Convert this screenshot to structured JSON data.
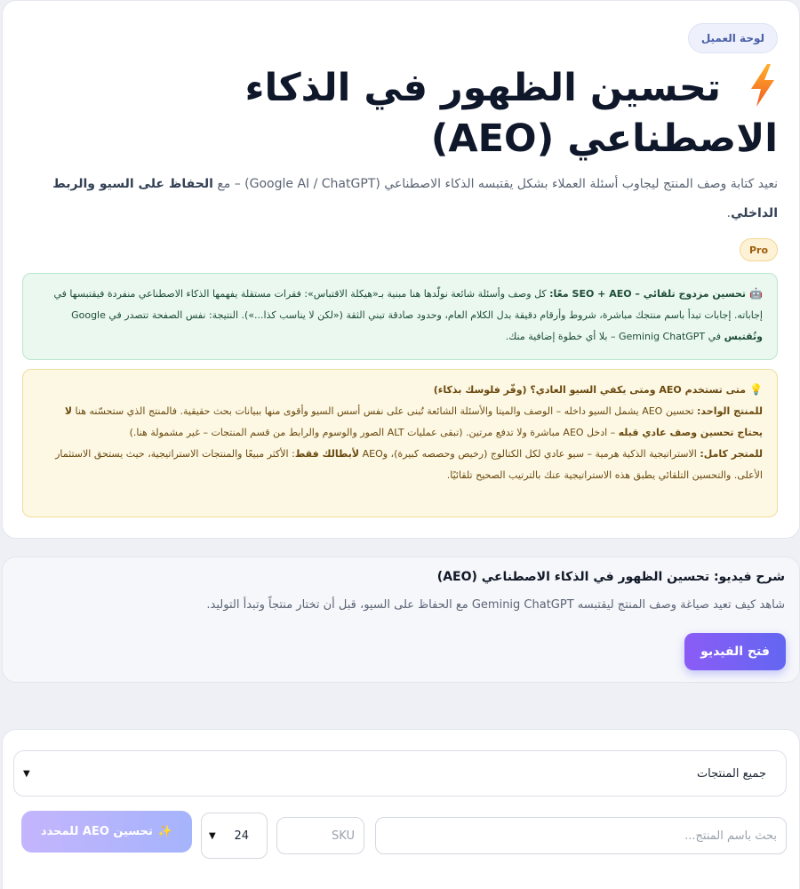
{
  "hero": {
    "crumb": "لوحة العميل",
    "title_icon": "lightning-icon",
    "title": "تحسين الظهور في الذكاء الاصطناعي (AEO)",
    "lead_text": "نعيد كتابة وصف المنتج ليجاوب أسئلة العملاء بشكل يقتبسه الذكاء الاصطناعي (Google AI / ChatGPT) – مع",
    "lead_bold": "الحفاظ على السيو والربط الداخلي",
    "lead_end": ".",
    "badge": "Pro"
  },
  "info_green": {
    "icon": "robot-icon",
    "head": "تحسين مزدوج تلقائي – SEO + AEO معًا:",
    "body1": "كل وصف وأسئلة شائعة نولّدها هنا مبنية بـ«هيكلة الاقتباس»: فقرات مستقلة يفهمها الذكاء الاصطناعي منفردة فيقتبسها في إجاباته. إجابات تبدأ باسم منتجك مباشرة، شروط وأرقام دقيقة بدل الكلام العام، وحدود صادقة تبني الثقة («لكن لا يناسب كذا...»). النتيجة: نفس الصفحة تتصدر في Google",
    "bold1": "وتُقتبس",
    "body2": "في Geminig ChatGPT – بلا أي خطوة إضافية منك."
  },
  "info_yellow": {
    "icon": "bulb-icon",
    "head": "متى تستخدم AEO ومتى يكفي السيو العادي؟ (وفّر فلوسك بذكاء)",
    "p1_label": "للمنتج الواحد:",
    "p1_text1": "تحسين AEO يشمل السيو داخله – الوصف والميتا والأسئلة الشائعة تُبنى على نفس أسس السيو وأقوى منها ببيانات بحث حقيقية. فالمنتج الذي ستحسّنه هنا",
    "p1_bold": "لا يحتاج تحسين وصف عادي قبله",
    "p1_text2": "– ادخل AEO مباشرة ولا تدفع مرتين. (تبقى عمليات ALT الصور والوسوم والرابط من قسم المنتجات – غير مشمولة هنا.)",
    "p2_label": "للمتجر كامل:",
    "p2_text1": "الاستراتيجية الذكية هرمية – سيو عادي لكل الكتالوج (رخيص وحصصه كبيرة)، وAEO",
    "p2_bold": "لأبطالك فقط",
    "p2_text2": ": الأكثر مبيعًا والمنتجات الاستراتيجية، حيث يستحق الاستثمار الأعلى. والتحسين التلقائي يطبق هذه الاستراتيجية عنك بالترتيب الصحيح تلقائيًا."
  },
  "video": {
    "title": "شرح فيديو: تحسين الظهور في الذكاء الاصطناعي (AEO)",
    "desc": "شاهد كيف تعيد صياغة وصف المنتج ليقتبسه Geminig ChatGPT مع الحفاظ على السيو، قبل أن تختار منتجاً وتبدأ التوليد.",
    "button": "فتح الفيديو"
  },
  "filters": {
    "category_selected": "جميع المنتجات",
    "search_placeholder": "بحث باسم المنتج...",
    "sku_placeholder": "SKU",
    "per_page": "24",
    "aeo_button": "تحسين AEO للمحدد",
    "aeo_icon": "sparkles-icon"
  }
}
